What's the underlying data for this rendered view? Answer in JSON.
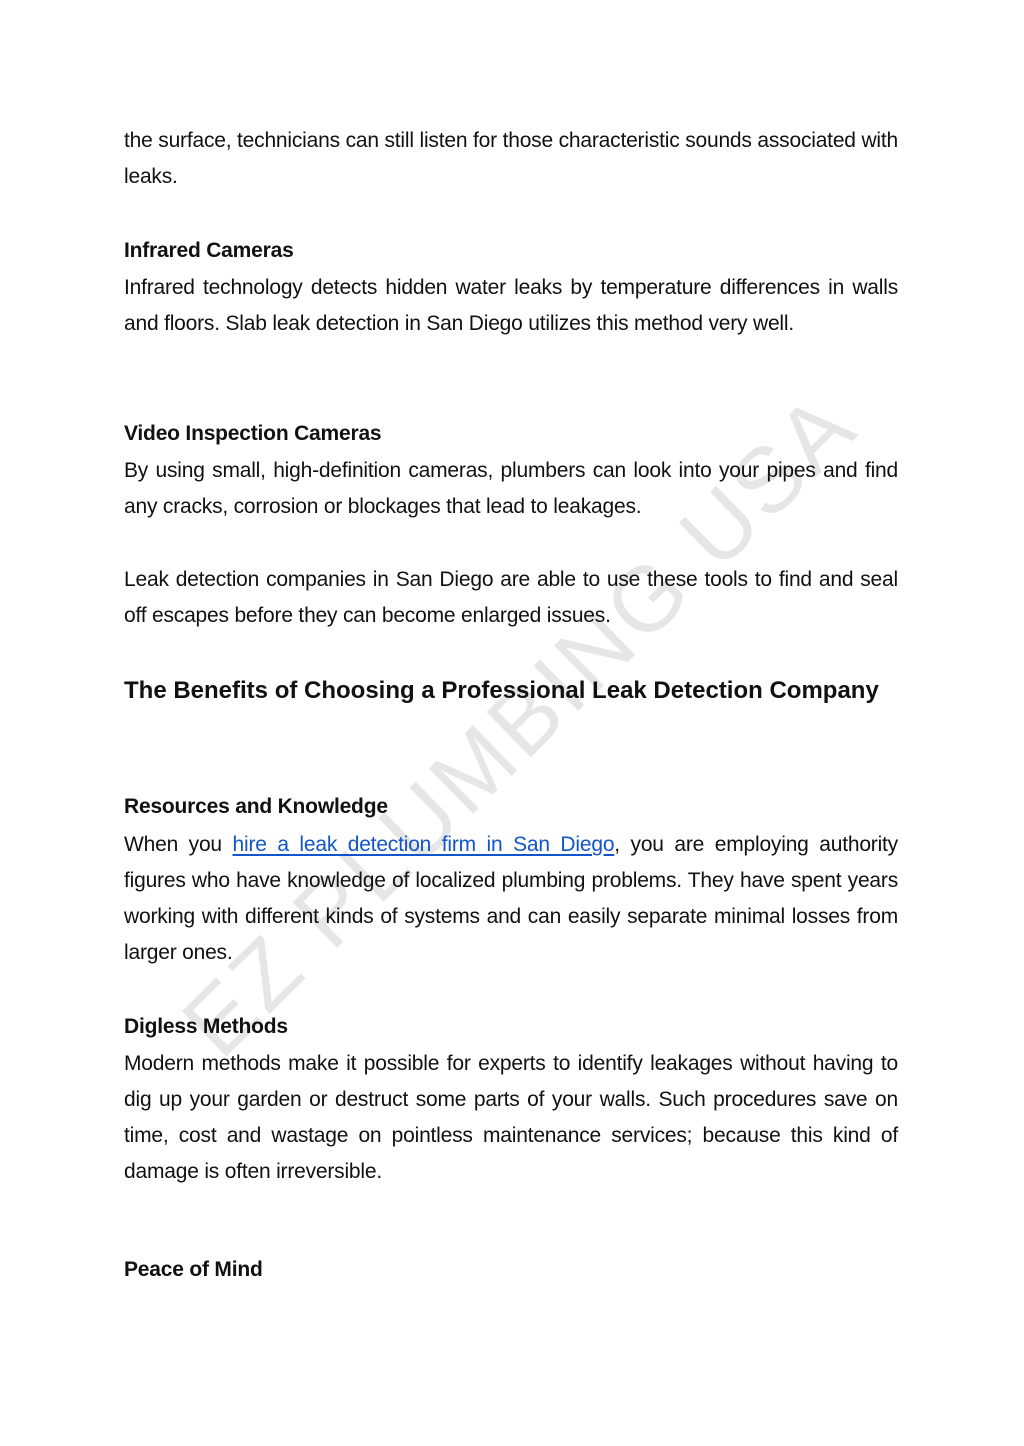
{
  "watermark": "EZ PLUMBING USA",
  "colors": {
    "text": "#111111",
    "link": "#1155cc",
    "watermark": "#e6e6e6",
    "background": "#ffffff"
  },
  "blocks": {
    "intro_continuation": "the surface, technicians can still listen for those characteristic sounds associated with leaks.",
    "infrared": {
      "heading": "Infrared Cameras",
      "text": "Infrared technology detects hidden water leaks by temperature differences in walls and floors. Slab leak detection in San Diego utilizes this method very well."
    },
    "video": {
      "heading": "Video Inspection Cameras",
      "text": "By using small, high-definition cameras, plumbers can look into your pipes and find any cracks, corrosion or blockages that lead to leakages."
    },
    "companies_paragraph": "Leak detection companies in San Diego are able to use these tools to find and seal off escapes before they can become enlarged issues.",
    "benefits_heading": "The Benefits of Choosing a Professional Leak Detection Company",
    "resources": {
      "heading": "Resources and Knowledge",
      "text_before_link": "When you ",
      "link_text": "hire a leak detection firm in San Diego",
      "text_after_link": ", you are employing authority figures who have knowledge of localized plumbing problems. They have spent years working with different kinds of systems and can easily separate minimal losses from larger ones."
    },
    "digless": {
      "heading": "Digless Methods",
      "text": "Modern methods make it possible for experts to identify leakages without having to dig up your garden or destruct some parts of your walls. Such procedures save on time, cost and wastage on pointless maintenance services; because this kind of damage is often irreversible."
    },
    "peace": {
      "heading": "Peace of Mind"
    }
  }
}
